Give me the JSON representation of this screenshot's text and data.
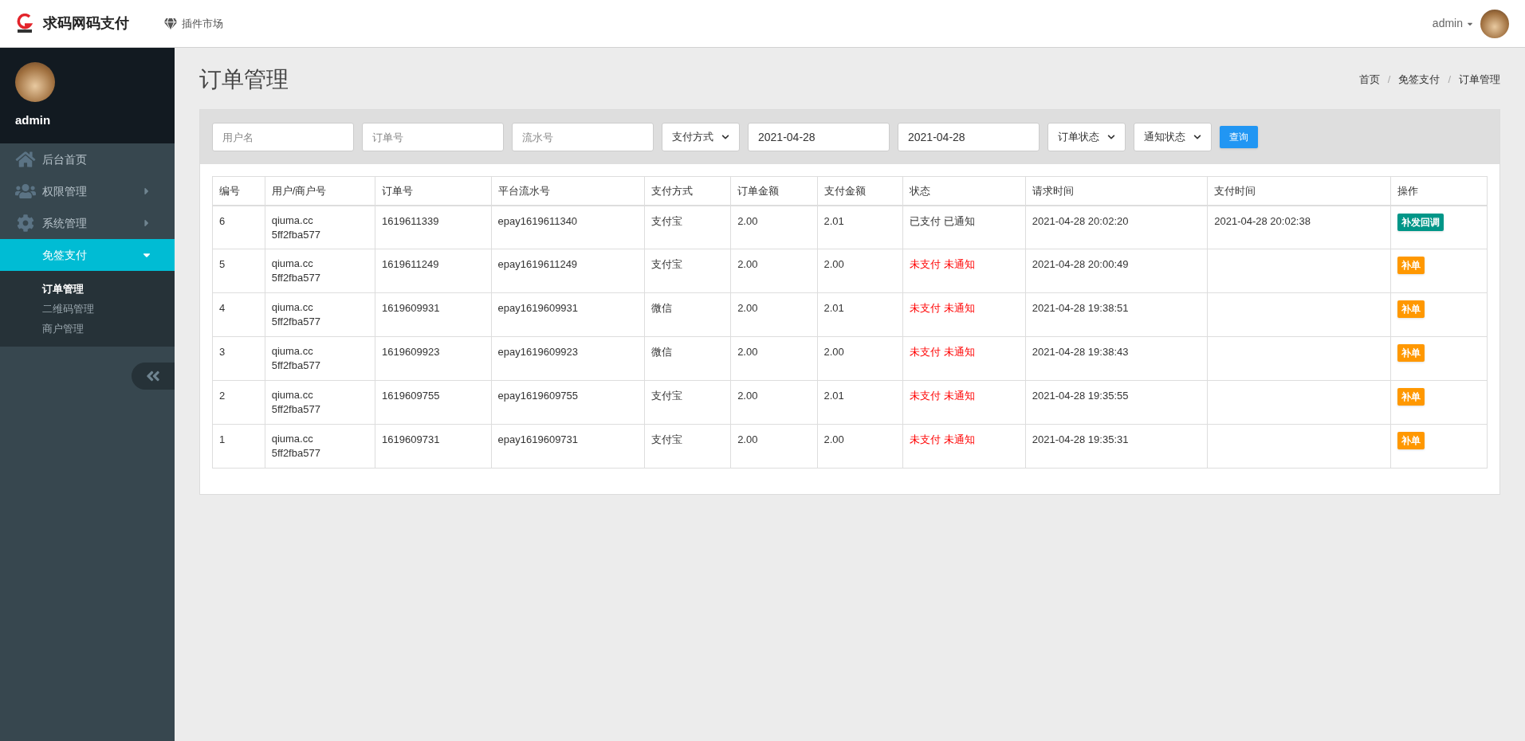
{
  "header": {
    "brand": "求码网码支付",
    "plugin_link": "插件市场",
    "user": "admin"
  },
  "sidebar": {
    "user": "admin",
    "items": [
      {
        "label": "后台首页",
        "kind": "home",
        "selected": false
      },
      {
        "label": "权限管理",
        "kind": "users",
        "selected": false,
        "expanded": false
      },
      {
        "label": "系统管理",
        "kind": "gear",
        "selected": false,
        "expanded": false
      },
      {
        "label": "免签支付",
        "kind": "none",
        "selected": true,
        "expanded": true,
        "children": [
          {
            "label": "订单管理",
            "selected": true
          },
          {
            "label": "二维码管理",
            "selected": false
          },
          {
            "label": "商户管理",
            "selected": false
          }
        ]
      }
    ]
  },
  "page": {
    "title": "订单管理",
    "breadcrumb": [
      "首页",
      "免签支付",
      "订单管理"
    ],
    "breadcrumb_separator": "/"
  },
  "filters": [
    {
      "kind": "input",
      "placeholder": "用户名"
    },
    {
      "kind": "input",
      "placeholder": "订单号"
    },
    {
      "kind": "input",
      "placeholder": "流水号"
    },
    {
      "kind": "select",
      "value": "支付方式"
    },
    {
      "kind": "date",
      "value": "2021-04-28"
    },
    {
      "kind": "date",
      "value": "2021-04-28"
    },
    {
      "kind": "select",
      "value": "订单状态"
    },
    {
      "kind": "select",
      "value": "通知状态"
    }
  ],
  "search_button": "查询",
  "table": {
    "columns": [
      "编号",
      "用户/商户号",
      "订单号",
      "平台流水号",
      "支付方式",
      "订单金额",
      "支付金额",
      "状态",
      "请求时间",
      "支付时间",
      "操作"
    ],
    "rows": [
      {
        "id": "6",
        "user": "qiuma.cc",
        "merchant": "5ff2fba577",
        "order_no": "1619611339",
        "serial": "epay1619611340",
        "method": "支付宝",
        "order_amount": "2.00",
        "paid_amount": "2.01",
        "status": "已支付 已通知",
        "paid": true,
        "request_time": "2021-04-28 20:02:20",
        "pay_time": "2021-04-28 20:02:38",
        "action": {
          "label": "补发回调",
          "kind": "resend"
        }
      },
      {
        "id": "5",
        "user": "qiuma.cc",
        "merchant": "5ff2fba577",
        "order_no": "1619611249",
        "serial": "epay1619611249",
        "method": "支付宝",
        "order_amount": "2.00",
        "paid_amount": "2.00",
        "status": "未支付 未通知",
        "paid": false,
        "request_time": "2021-04-28 20:00:49",
        "action": {
          "label": "补单",
          "kind": "supplement"
        }
      },
      {
        "id": "4",
        "user": "qiuma.cc",
        "merchant": "5ff2fba577",
        "order_no": "1619609931",
        "serial": "epay1619609931",
        "method": "微信",
        "order_amount": "2.00",
        "paid_amount": "2.01",
        "status": "未支付 未通知",
        "paid": false,
        "request_time": "2021-04-28 19:38:51",
        "action": {
          "label": "补单",
          "kind": "supplement"
        }
      },
      {
        "id": "3",
        "user": "qiuma.cc",
        "merchant": "5ff2fba577",
        "order_no": "1619609923",
        "serial": "epay1619609923",
        "method": "微信",
        "order_amount": "2.00",
        "paid_amount": "2.00",
        "status": "未支付 未通知",
        "paid": false,
        "request_time": "2021-04-28 19:38:43",
        "action": {
          "label": "补单",
          "kind": "supplement"
        }
      },
      {
        "id": "2",
        "user": "qiuma.cc",
        "merchant": "5ff2fba577",
        "order_no": "1619609755",
        "serial": "epay1619609755",
        "method": "支付宝",
        "order_amount": "2.00",
        "paid_amount": "2.01",
        "status": "未支付 未通知",
        "paid": false,
        "request_time": "2021-04-28 19:35:55",
        "action": {
          "label": "补单",
          "kind": "supplement"
        }
      },
      {
        "id": "1",
        "user": "qiuma.cc",
        "merchant": "5ff2fba577",
        "order_no": "1619609731",
        "serial": "epay1619609731",
        "method": "支付宝",
        "order_amount": "2.00",
        "paid_amount": "2.00",
        "status": "未支付 未通知",
        "paid": false,
        "request_time": "2021-04-28 19:35:31",
        "action": {
          "label": "补单",
          "kind": "supplement"
        }
      }
    ]
  }
}
